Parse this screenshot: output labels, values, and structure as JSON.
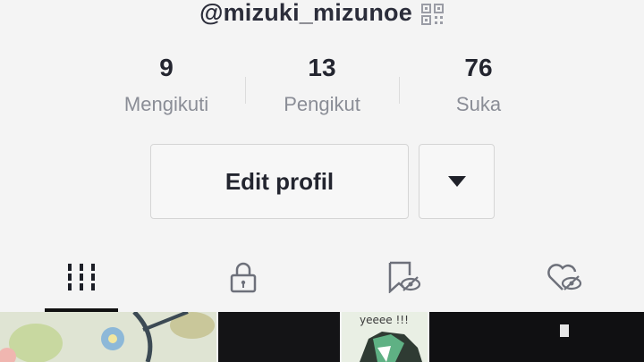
{
  "profile": {
    "username": "@mizuki_mizunoe"
  },
  "stats": [
    {
      "value": "9",
      "label": "Mengikuti"
    },
    {
      "value": "13",
      "label": "Pengikut"
    },
    {
      "value": "76",
      "label": "Suka"
    }
  ],
  "actions": {
    "edit_label": "Edit profil"
  },
  "tabs": [
    {
      "icon": "grid-icon",
      "active": true
    },
    {
      "icon": "lock-icon",
      "active": false
    },
    {
      "icon": "bookmark-hidden-icon",
      "active": false
    },
    {
      "icon": "heart-hidden-icon",
      "active": false
    }
  ],
  "thumbnails": {
    "third_caption": "yeeee !!!"
  }
}
